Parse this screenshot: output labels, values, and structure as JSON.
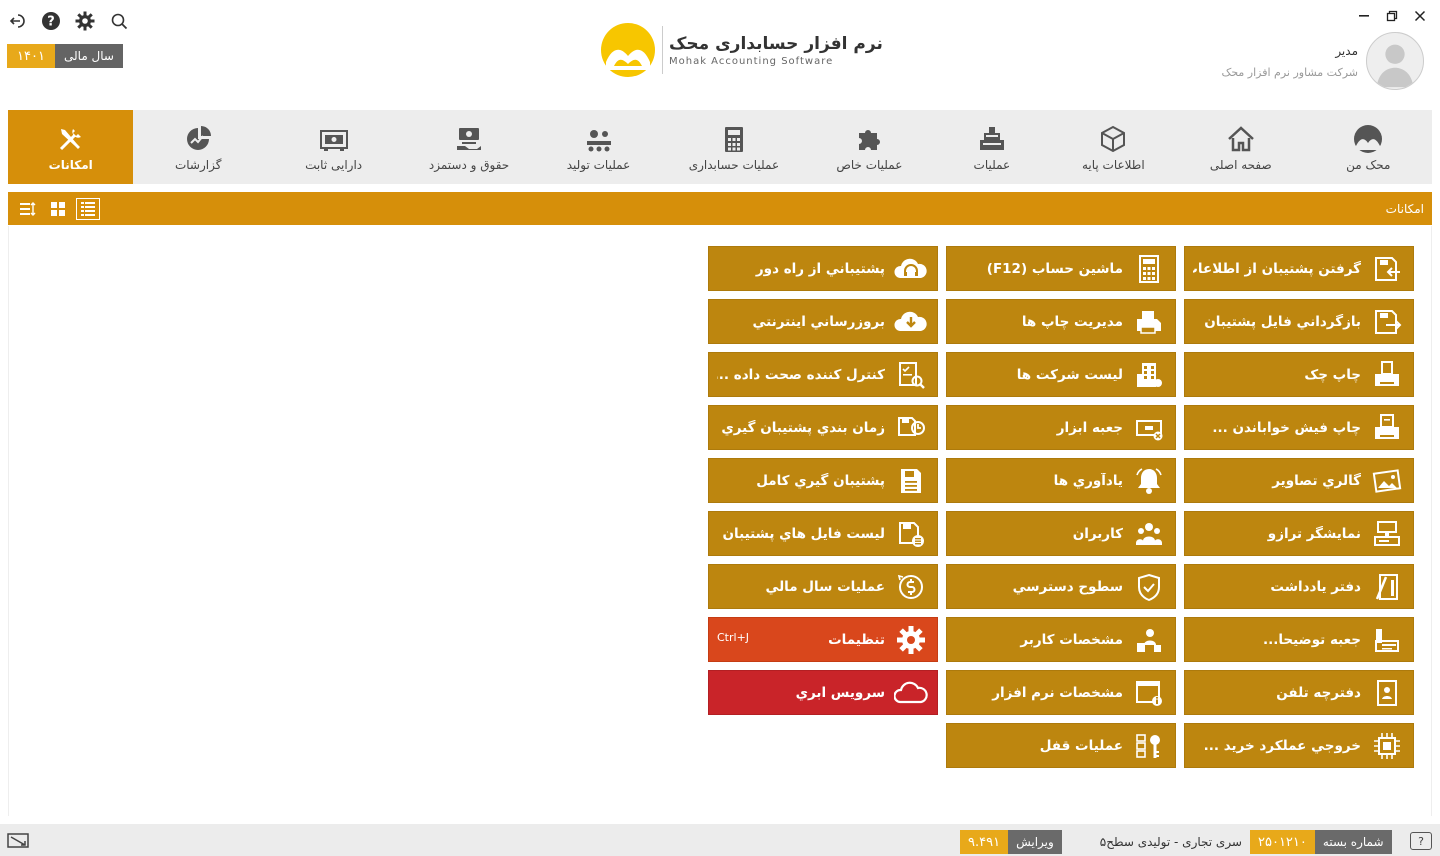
{
  "window": {
    "minimize_label": "—",
    "restore_label": "❐",
    "close_label": "✕"
  },
  "fiscal_year": {
    "label": "سال مالی",
    "value": "۱۴۰۱"
  },
  "logo": {
    "fa": "نرم افزار حسابداری محک",
    "en": "Mohak Accounting Software",
    "color": "#f7c600"
  },
  "user": {
    "name": "مدیر",
    "company": "شرکت مشاور نرم افزار محک"
  },
  "ribbon": {
    "tabs": [
      {
        "label": "محک من",
        "icon": "mohak-logo-icon"
      },
      {
        "label": "صفحه اصلی",
        "icon": "home-icon"
      },
      {
        "label": "اطلاعات پایه",
        "icon": "box-icon"
      },
      {
        "label": "عملیات",
        "icon": "cash-register-icon"
      },
      {
        "label": "عملیات خاص",
        "icon": "puzzle-icon"
      },
      {
        "label": "عملیات حسابداری",
        "icon": "calculator-icon"
      },
      {
        "label": "عملیات تولید",
        "icon": "production-icon"
      },
      {
        "label": "حقوق و دستمزد",
        "icon": "salary-icon"
      },
      {
        "label": "دارایی ثابت",
        "icon": "safe-icon"
      },
      {
        "label": "گزارشات",
        "icon": "chart-icon"
      },
      {
        "label": "امکانات",
        "icon": "tools-icon"
      }
    ],
    "active_index": 10
  },
  "section": {
    "title": "امکانات"
  },
  "tiles": {
    "col1": [
      {
        "label": "گرفتن پشتيبان از اطلاعات",
        "icon": "backup-icon"
      },
      {
        "label": "بازگرداني فايل پشتيبان",
        "icon": "restore-icon"
      },
      {
        "label": "چاپ چک",
        "icon": "check-print-icon"
      },
      {
        "label": "چاپ فيش خواباندن ...",
        "icon": "deposit-print-icon"
      },
      {
        "label": "گالري تصاوير",
        "icon": "gallery-icon"
      },
      {
        "label": "نمايشگر ترازو",
        "icon": "scale-icon"
      },
      {
        "label": "دفتر يادداشت",
        "icon": "notebook-icon"
      },
      {
        "label": "جعبه توضيحا...",
        "icon": "comment-box-icon"
      },
      {
        "label": "دفترچه تلفن",
        "icon": "phonebook-icon"
      },
      {
        "label": "خروجي عملکرد خريد ...",
        "icon": "chip-icon"
      }
    ],
    "col2": [
      {
        "label": "ماشين حساب (F12)",
        "icon": "calculator-icon"
      },
      {
        "label": "مديريت چاپ ها",
        "icon": "printer-icon"
      },
      {
        "label": "ليست شرکت ها",
        "icon": "building-icon"
      },
      {
        "label": "جعبه ابزار",
        "icon": "toolbox-icon"
      },
      {
        "label": "يادآوري ها",
        "icon": "bell-icon"
      },
      {
        "label": "کاربران",
        "icon": "users-icon"
      },
      {
        "label": "سطوح دسترسي",
        "icon": "shield-icon"
      },
      {
        "label": "مشخصات کاربر",
        "icon": "user-card-icon"
      },
      {
        "label": "مشخصات نرم افزار",
        "icon": "software-info-icon"
      },
      {
        "label": "عمليات قفل",
        "icon": "lock-key-icon"
      }
    ],
    "col3": [
      {
        "label": "پشتيباني از راه دور",
        "icon": "headset-cloud-icon",
        "color": ""
      },
      {
        "label": "بروزرساني اينترنتي",
        "icon": "cloud-download-icon",
        "color": ""
      },
      {
        "label": "کنترل کننده صحت داده ...",
        "icon": "data-check-icon",
        "color": ""
      },
      {
        "label": "زمان بندي پشتيبان گيري",
        "icon": "backup-schedule-icon",
        "color": ""
      },
      {
        "label": "پشتيبان گيري کامل",
        "icon": "full-backup-icon",
        "color": ""
      },
      {
        "label": "ليست فايل هاي پشتيبان",
        "icon": "backup-list-icon",
        "color": ""
      },
      {
        "label": "عمليات سال مالي",
        "icon": "dollar-cycle-icon",
        "color": ""
      },
      {
        "label": "تنظيمات",
        "icon": "gear-icon",
        "color": "orange",
        "shortcut": "Ctrl+J"
      },
      {
        "label": "سرويس ابري",
        "icon": "cloud-icon",
        "color": "red"
      }
    ]
  },
  "status": {
    "help": "?",
    "package_label": "شماره بسته",
    "package_value": "۲۵۰۱۲۱۰",
    "edition": "سری تجاری - تولیدی سطح۵",
    "version_label": "ویرایش",
    "version_value": "۹.۴۹۱"
  },
  "colors": {
    "accent": "#d68f0a",
    "tile": "#bd860f",
    "orange_tile": "#d9471c",
    "red_tile": "#c92429"
  }
}
